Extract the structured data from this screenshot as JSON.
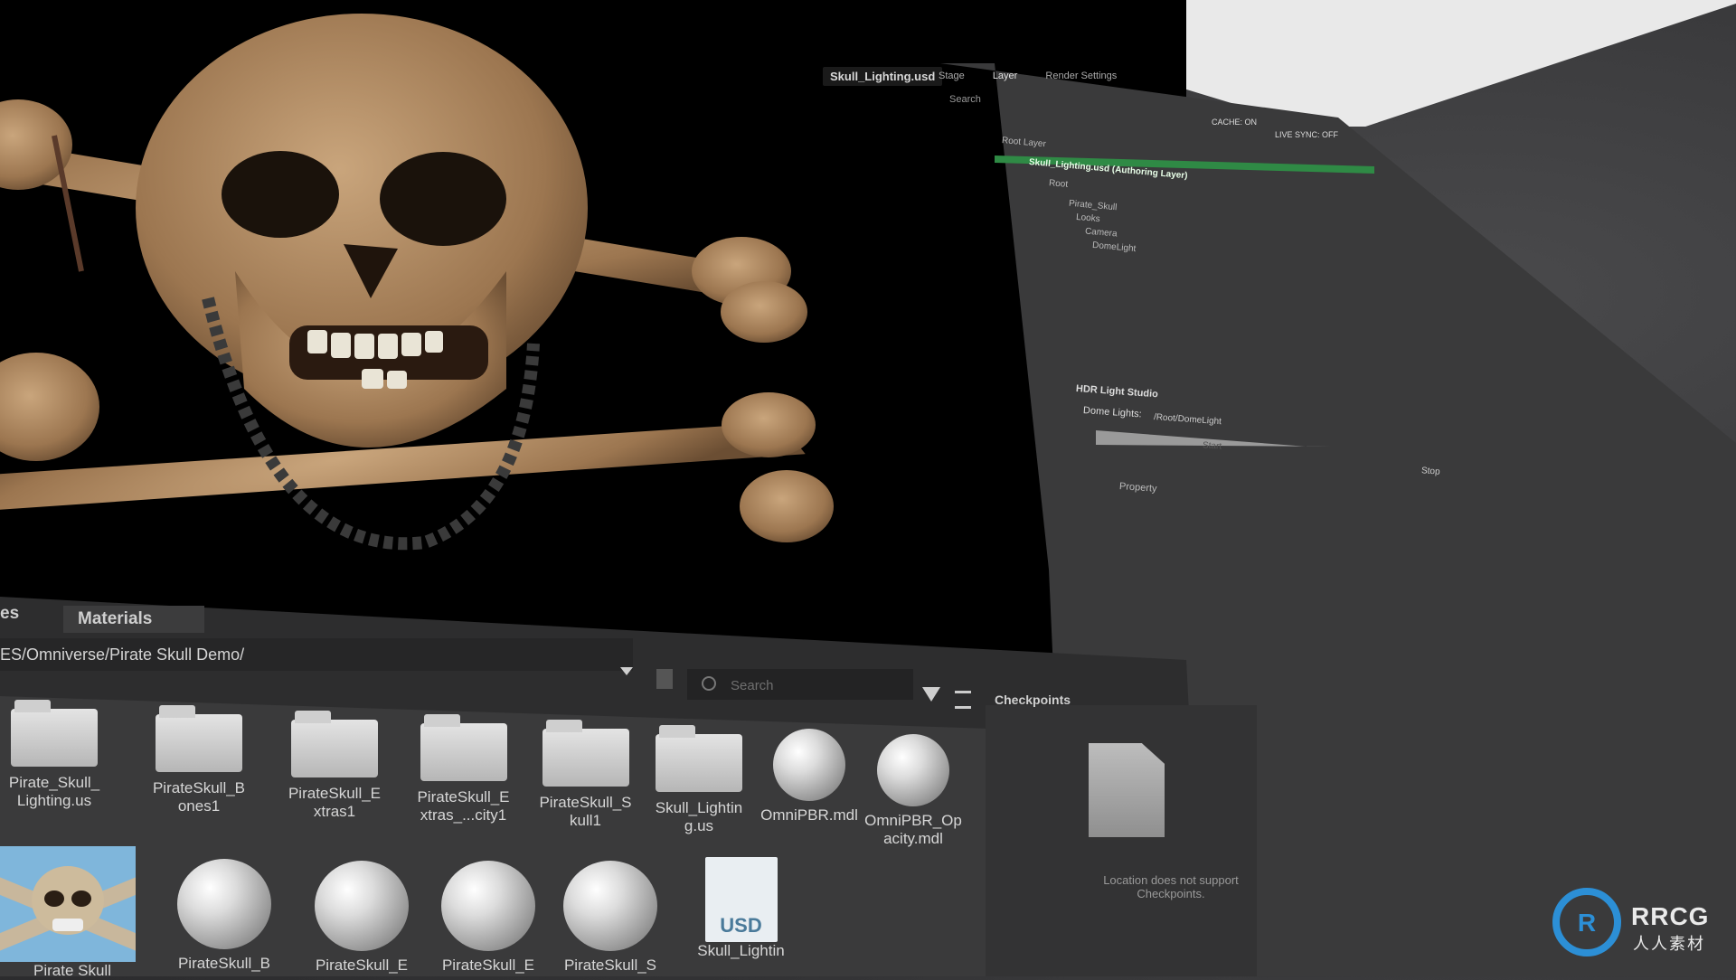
{
  "viewport": {
    "stage_file": "Skull_Lighting.usd"
  },
  "stage_panel": {
    "top_tabs": [
      "Stage",
      "Layer",
      "Render Settings"
    ],
    "sub_tabs": [
      "Search"
    ],
    "cache_label": "CACHE: ON",
    "live_sync_label": "LIVE SYNC: OFF",
    "root_layer": "Root Layer",
    "authoring_layer": "Skull_Lighting.usd (Authoring Layer)",
    "tree": [
      "Root",
      "Pirate_Skull",
      "Looks",
      "Camera",
      "DomeLight"
    ]
  },
  "hdr_panel": {
    "title": "HDR Light Studio",
    "dome_lights_label": "Dome Lights:",
    "dome_lights_value": "/Root/DomeLight",
    "start_label": "Start",
    "stop_label": "Stop",
    "property_tab": "Property"
  },
  "browser": {
    "tab_partial": "es",
    "tab_materials": "Materials",
    "path": "ES/Omniverse/Pirate Skull Demo/",
    "search_placeholder": "Search",
    "checkpoints_title": "Checkpoints",
    "checkpoints_message": "Location does not support Checkpoints.",
    "row1": [
      {
        "name": "Pirate_Skull_\nLighting.us",
        "kind": "folder"
      },
      {
        "name": "PirateSkull_B\nones1",
        "kind": "folder"
      },
      {
        "name": "PirateSkull_E\nxtras1",
        "kind": "folder"
      },
      {
        "name": "PirateSkull_E\nxtras_...city1",
        "kind": "folder"
      },
      {
        "name": "PirateSkull_S\nkull1",
        "kind": "folder"
      },
      {
        "name": "Skull_Lightin\ng.us",
        "kind": "folder"
      },
      {
        "name": "OmniPBR.mdl",
        "kind": "sphere"
      },
      {
        "name": "OmniPBR_Op\nacity.mdl",
        "kind": "sphere"
      }
    ],
    "row2": [
      {
        "name": "Pirate Skull",
        "kind": "thumb"
      },
      {
        "name": "PirateSkull_B",
        "kind": "sphere"
      },
      {
        "name": "PirateSkull_E",
        "kind": "sphere"
      },
      {
        "name": "PirateSkull_E",
        "kind": "sphere"
      },
      {
        "name": "PirateSkull_S",
        "kind": "sphere"
      },
      {
        "name": "Skull_Lightin",
        "kind": "usd"
      }
    ],
    "usd_badge": "USD"
  },
  "watermark": {
    "brand": "RRCG",
    "sub": "人人素材"
  }
}
